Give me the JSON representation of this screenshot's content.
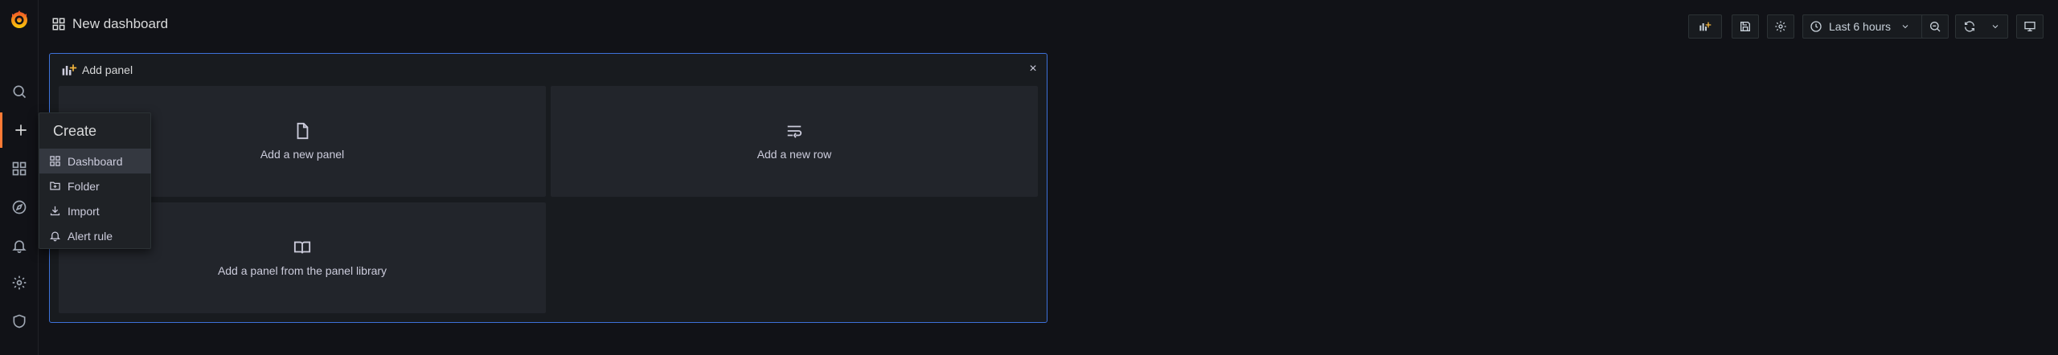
{
  "app": {
    "title": "New dashboard"
  },
  "sidebar": {
    "items": [
      {
        "name": "search",
        "icon": "search-icon"
      },
      {
        "name": "create",
        "icon": "plus-icon"
      },
      {
        "name": "dashboards",
        "icon": "apps-icon"
      },
      {
        "name": "explore",
        "icon": "compass-icon"
      },
      {
        "name": "alerting",
        "icon": "bell-icon"
      },
      {
        "name": "configuration",
        "icon": "gear-icon"
      },
      {
        "name": "server-admin",
        "icon": "shield-icon"
      }
    ]
  },
  "toolbar": {
    "time_range_label": "Last 6 hours",
    "icons": [
      "add-panel-icon",
      "save-icon",
      "gear-icon",
      "clock-icon",
      "zoom-out-icon",
      "refresh-icon",
      "chevron-down-icon",
      "tv-icon"
    ]
  },
  "add_panel": {
    "title": "Add panel",
    "close": "×",
    "options": [
      {
        "label": "Add a new panel"
      },
      {
        "label": "Add a new row"
      },
      {
        "label": "Add a panel from the panel library"
      }
    ]
  },
  "create_menu": {
    "title": "Create",
    "items": [
      {
        "label": "Dashboard"
      },
      {
        "label": "Folder"
      },
      {
        "label": "Import"
      },
      {
        "label": "Alert rule"
      }
    ]
  },
  "colors": {
    "accent": "#ff7a35",
    "selected_border": "#3d71d9",
    "background": "#111217"
  }
}
